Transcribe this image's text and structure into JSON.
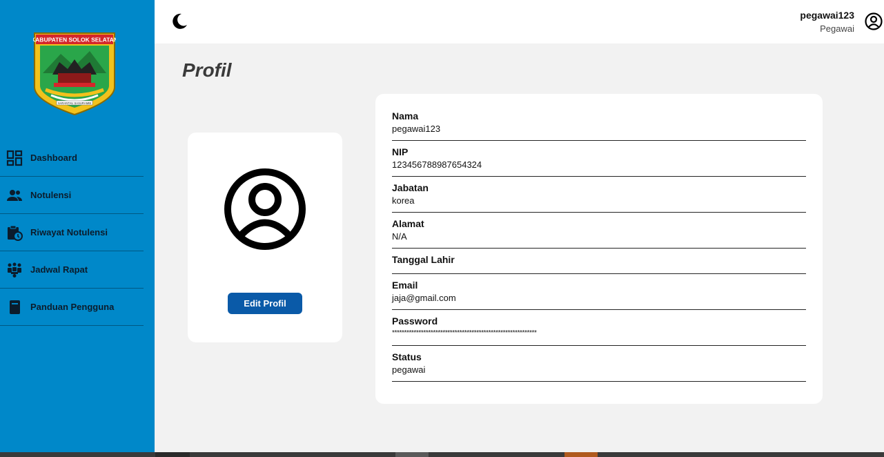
{
  "sidebar": {
    "logo_text": "KABUPATEN SOLOK SELATAN",
    "logo_motto": "SARANTAU SASURAMBI",
    "items": [
      {
        "label": "Dashboard",
        "icon": "dashboard-icon"
      },
      {
        "label": "Notulensi",
        "icon": "people-icon"
      },
      {
        "label": "Riwayat Notulensi",
        "icon": "clipboard-clock-icon"
      },
      {
        "label": "Jadwal Rapat",
        "icon": "meeting-icon"
      },
      {
        "label": "Panduan Pengguna",
        "icon": "book-icon"
      }
    ]
  },
  "header": {
    "theme_icon": "moon-icon",
    "username": "pegawai123",
    "role": "Pegawai",
    "user_icon": "user-circle-icon"
  },
  "page": {
    "title": "Profil"
  },
  "profile_card": {
    "avatar_icon": "user-circle-icon",
    "edit_label": "Edit Profil"
  },
  "fields": [
    {
      "label": "Nama",
      "value": "pegawai123"
    },
    {
      "label": "NIP",
      "value": "123456788987654324"
    },
    {
      "label": "Jabatan",
      "value": "korea"
    },
    {
      "label": "Alamat",
      "value": "N/A"
    },
    {
      "label": "Tanggal Lahir",
      "value": ""
    },
    {
      "label": "Email",
      "value": "jaja@gmail.com"
    },
    {
      "label": "Password",
      "value": "************************************************************"
    },
    {
      "label": "Status",
      "value": "pegawai"
    }
  ],
  "colors": {
    "sidebar": "#0088c9",
    "button": "#0a5aa8",
    "background": "#f2f2f2"
  }
}
